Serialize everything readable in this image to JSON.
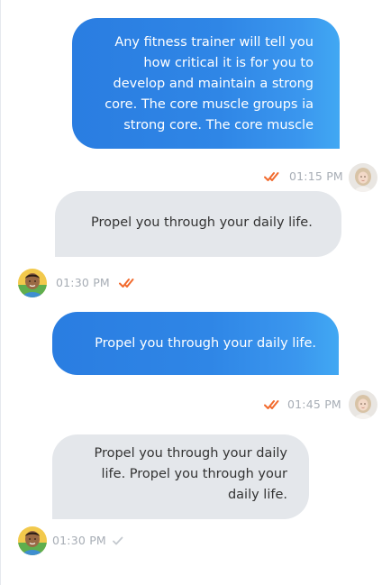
{
  "messages": [
    {
      "direction": "outgoing",
      "text": "Any fitness trainer will tell you how critical it is for you to develop and maintain a strong core. The core muscle groups ia strong core. The core muscle",
      "time": "01:15 PM",
      "status": "read",
      "avatar": "woman-avatar"
    },
    {
      "direction": "incoming",
      "text": "Propel you through your daily life.",
      "time": "01:30 PM",
      "status": "read",
      "avatar": "boy-avatar"
    },
    {
      "direction": "outgoing",
      "text": "Propel you through your daily life.",
      "time": "01:45 PM",
      "status": "read",
      "avatar": "woman-avatar"
    },
    {
      "direction": "incoming",
      "text": "Propel you through your daily life. Propel you through your daily life.",
      "time": "01:30 PM",
      "status": "sent",
      "avatar": "boy-avatar"
    }
  ],
  "colors": {
    "outgoing_bubble_start": "#2a7de1",
    "outgoing_bubble_end": "#41a8f3",
    "incoming_bubble": "#e4e7eb",
    "read_tick": "#f26b2e",
    "sent_tick": "#c4c9cf",
    "meta_text": "#a7adb5"
  },
  "icons": {
    "read": "double-check-icon",
    "sent": "single-check-icon"
  }
}
